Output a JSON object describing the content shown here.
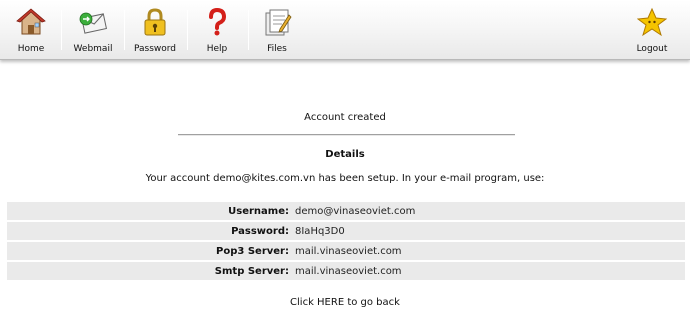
{
  "toolbar": {
    "items": [
      {
        "label": "Home",
        "icon": "home-icon"
      },
      {
        "label": "Webmail",
        "icon": "webmail-icon"
      },
      {
        "label": "Password",
        "icon": "padlock-icon"
      },
      {
        "label": "Help",
        "icon": "question-mark-icon"
      },
      {
        "label": "Files",
        "icon": "files-icon"
      }
    ],
    "logout": {
      "label": "Logout",
      "icon": "star-icon"
    }
  },
  "main": {
    "message": "Account created",
    "details_title": "Details",
    "setup_text": "Your account demo@kites.com.vn has been setup. In your e-mail program, use:",
    "rows": [
      {
        "key": "Username:",
        "value": "demo@vinaseoviet.com"
      },
      {
        "key": "Password:",
        "value": "8IaHq3D0"
      },
      {
        "key": "Pop3 Server:",
        "value": "mail.vinaseoviet.com"
      },
      {
        "key": "Smtp Server:",
        "value": "mail.vinaseoviet.com"
      }
    ],
    "back_link": "Click HERE to go back"
  },
  "colors": {
    "row_bg": "#eaeaea",
    "toolbar_bg": "#f4f4f4",
    "star": "#f5c400"
  }
}
